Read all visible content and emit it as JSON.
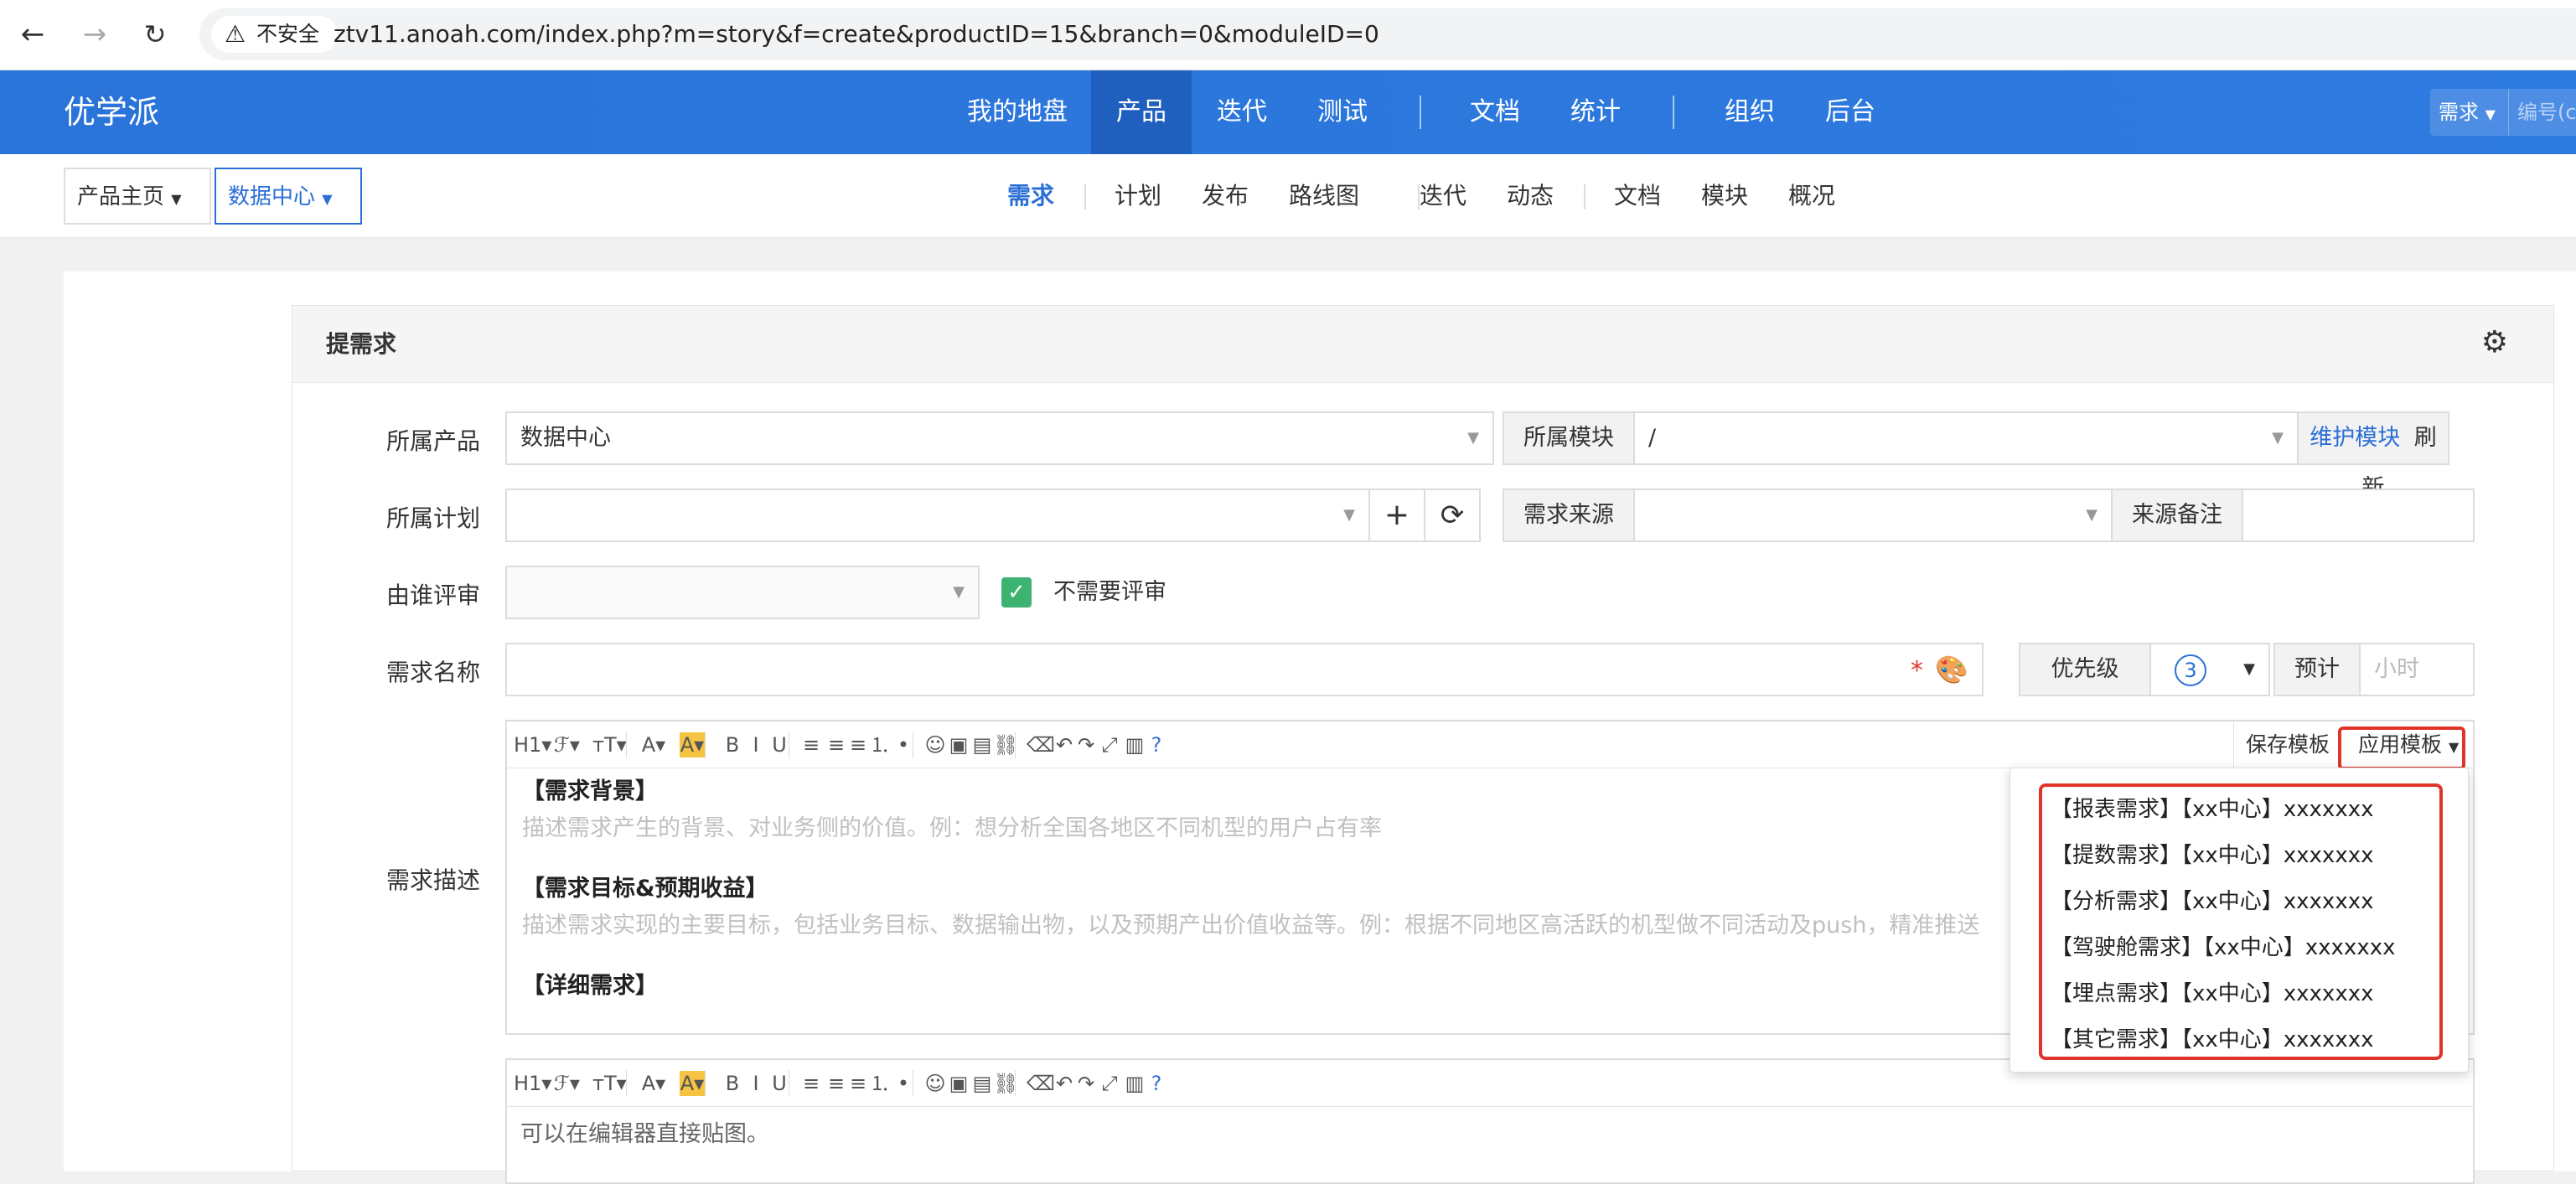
{
  "browser": {
    "insecure_label": "不安全",
    "url": "ztv11.anoah.com/index.php?m=story&f=create&productID=15&branch=0&moduleID=0"
  },
  "header": {
    "brand": "优学派",
    "nav": [
      "我的地盘",
      "产品",
      "迭代",
      "测试",
      "文档",
      "统计",
      "组织",
      "后台"
    ],
    "active_nav": "产品",
    "search_type": "需求",
    "search_placeholder": "编号(ct"
  },
  "subheader": {
    "crumbs": [
      "产品主页",
      "数据中心"
    ],
    "nav": [
      "需求",
      "计划",
      "发布",
      "路线图",
      "迭代",
      "动态",
      "文档",
      "模块",
      "概况"
    ],
    "active": "需求"
  },
  "form": {
    "title": "提需求",
    "product_label": "所属产品",
    "product_value": "数据中心",
    "module_label": "所属模块",
    "module_value": "/",
    "maintain_module": "维护模块",
    "refresh": "刷新",
    "plan_label": "所属计划",
    "plan_value": "",
    "source_label": "需求来源",
    "source_value": "",
    "source_note_label": "来源备注",
    "reviewer_label": "由谁评审",
    "no_review_label": "不需要评审",
    "name_label": "需求名称",
    "required_mark": "*",
    "priority_label": "优先级",
    "priority_value": "3",
    "estimate_label": "预计",
    "estimate_placeholder": "小时",
    "desc_label": "需求描述",
    "save_template": "保存模板",
    "apply_template": "应用模板",
    "desc_content": [
      {
        "heading": "【需求背景】",
        "hint": "描述需求产生的背景、对业务侧的价值。例：想分析全国各地区不同机型的用户占有率"
      },
      {
        "heading": "【需求目标&预期收益】",
        "hint": "描述需求实现的主要目标，包括业务目标、数据输出物，以及预期产出价值收益等。例：根据不同地区高活跃的机型做不同活动及push，精准推送"
      },
      {
        "heading": "【详细需求】",
        "hint": ""
      }
    ],
    "second_editor_hint": "可以在编辑器直接贴图。"
  },
  "template_dropdown": [
    "【报表需求】【xx中心】xxxxxxx",
    "【提数需求】【xx中心】xxxxxxx",
    "【分析需求】【xx中心】xxxxxxx",
    "【驾驶舱需求】【xx中心】xxxxxxx",
    "【埋点需求】【xx中心】xxxxxxx",
    "【其它需求】【xx中心】xxxxxxx"
  ],
  "toolbar_icons": [
    "heading-icon",
    "font-family-icon",
    "font-size-icon",
    "font-color-icon",
    "highlight-icon",
    "bold-icon",
    "italic-icon",
    "underline-icon",
    "align-left-icon",
    "align-center-icon",
    "align-right-icon",
    "ordered-list-icon",
    "bullet-list-icon",
    "emoji-icon",
    "image-icon",
    "table-icon",
    "link-icon",
    "eraser-icon",
    "undo-icon",
    "redo-icon",
    "fullscreen-icon",
    "paste-icon",
    "help-icon"
  ],
  "colors": {
    "header_blue": "#2e7be0",
    "accent": "#2b6fd6",
    "highlight_red": "#e0342a",
    "check_green": "#3cb371"
  }
}
